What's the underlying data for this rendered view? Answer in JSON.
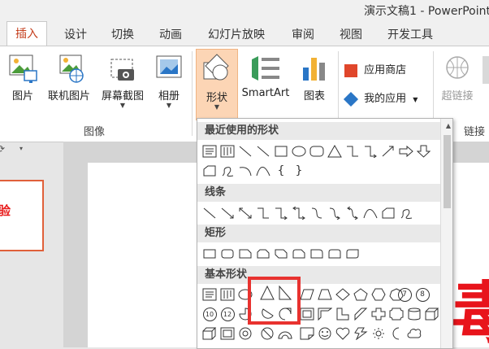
{
  "app": {
    "title": "演示文稿1 - PowerPoint"
  },
  "tabs": [
    {
      "label": "插入",
      "active": true
    },
    {
      "label": "设计"
    },
    {
      "label": "切换"
    },
    {
      "label": "动画"
    },
    {
      "label": "幻灯片放映"
    },
    {
      "label": "审阅"
    },
    {
      "label": "视图"
    },
    {
      "label": "开发工具"
    }
  ],
  "ribbon": {
    "images_group": {
      "label": "图像",
      "buttons": [
        {
          "label": "图片",
          "icon": "picture-icon"
        },
        {
          "label": "联机图片",
          "icon": "online-picture-icon"
        },
        {
          "label": "屏幕截图",
          "icon": "screenshot-icon"
        },
        {
          "label": "相册",
          "icon": "photo-album-icon"
        }
      ]
    },
    "illustrations": {
      "shapes_label": "形状",
      "smartart_label": "SmartArt",
      "chart_label": "图表"
    },
    "apps": {
      "store_label": "应用商店",
      "myapps_label": "我的应用"
    },
    "links": {
      "hyperlink_label": "超链接",
      "group_label": "链接"
    }
  },
  "slide_thumbnail": {
    "text": "验"
  },
  "shapes_gallery": {
    "sections": [
      "最近使用的形状",
      "线条",
      "矩形",
      "基本形状"
    ],
    "basic_shapes_numbered": [
      "7",
      "8",
      "10",
      "12"
    ]
  },
  "slide_text_fragment": "毒",
  "colors": {
    "accent": "#c43e1c",
    "highlight": "#e8322f",
    "shape_button_bg": "#fcd5b5"
  }
}
